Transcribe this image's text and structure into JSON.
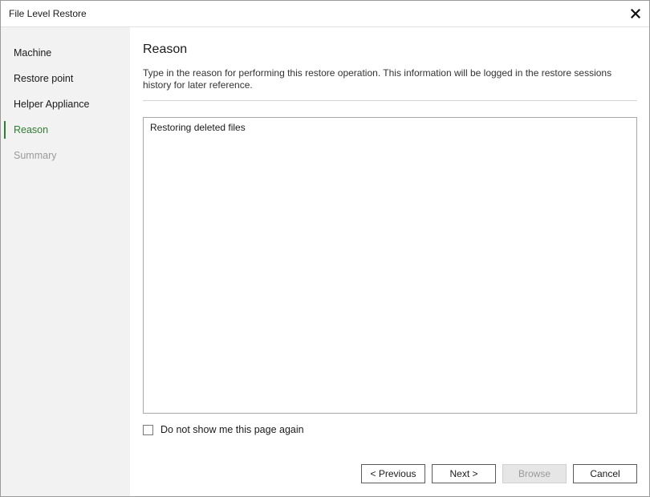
{
  "window": {
    "title": "File Level Restore"
  },
  "icons": {
    "close": "close-icon",
    "checkbox": "checkbox-icon"
  },
  "colors": {
    "active_step": "#2e7d32",
    "sidebar_bg": "#f2f2f2",
    "disabled_text": "#9a9a9a"
  },
  "sidebar": {
    "steps": [
      {
        "label": "Machine",
        "state": "done"
      },
      {
        "label": "Restore point",
        "state": "done"
      },
      {
        "label": "Helper Appliance",
        "state": "done"
      },
      {
        "label": "Reason",
        "state": "active"
      },
      {
        "label": "Summary",
        "state": "disabled"
      }
    ]
  },
  "main": {
    "heading": "Reason",
    "description": "Type in the reason for performing this restore operation. This information will be logged in the restore sessions history for later reference.",
    "reason_text": "Restoring deleted files",
    "dont_show_label": "Do not show me this page again",
    "dont_show_checked": false
  },
  "buttons": {
    "previous": "< Previous",
    "next": "Next >",
    "browse": "Browse",
    "cancel": "Cancel"
  }
}
